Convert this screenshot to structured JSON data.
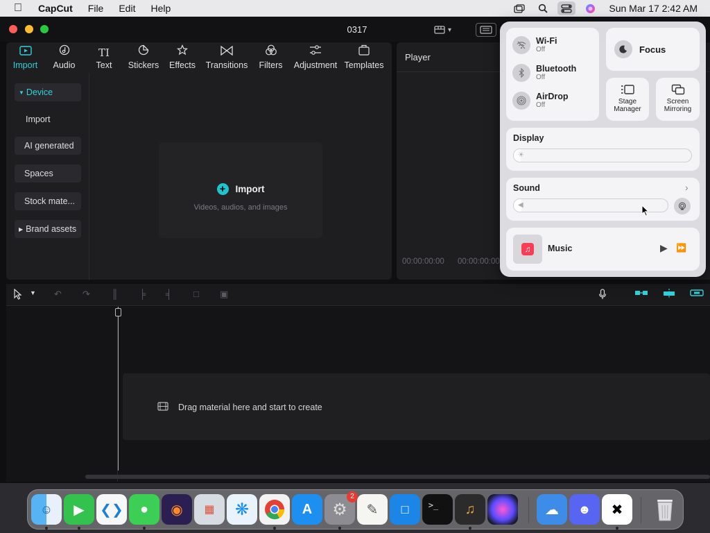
{
  "menubar": {
    "app_name": "CapCut",
    "menus": [
      "File",
      "Edit",
      "Help"
    ],
    "clock": "Sun Mar 17  2:42 AM"
  },
  "window": {
    "title": "0317"
  },
  "media": {
    "tabs": [
      {
        "label": "Import",
        "icon": "import-icon",
        "active": true
      },
      {
        "label": "Audio",
        "icon": "audio-icon"
      },
      {
        "label": "Text",
        "icon": "text-icon"
      },
      {
        "label": "Stickers",
        "icon": "stickers-icon"
      },
      {
        "label": "Effects",
        "icon": "effects-icon"
      },
      {
        "label": "Transitions",
        "icon": "transitions-icon"
      },
      {
        "label": "Filters",
        "icon": "filters-icon"
      },
      {
        "label": "Adjustment",
        "icon": "adjustment-icon"
      },
      {
        "label": "Templates",
        "icon": "templates-icon"
      }
    ],
    "sidebar": {
      "device": "Device",
      "import": "Import",
      "ai_generated": "AI generated",
      "spaces": "Spaces",
      "stock": "Stock mate...",
      "brand": "Brand assets"
    },
    "import_zone": {
      "title": "Import",
      "subtitle": "Videos, audios, and images"
    }
  },
  "player": {
    "title": "Player",
    "time_current": "00:00:00:00",
    "time_total": "00:00:00:00"
  },
  "timeline": {
    "drop_text": "Drag material here and start to create"
  },
  "control_center": {
    "wifi": {
      "name": "Wi-Fi",
      "state": "Off"
    },
    "bluetooth": {
      "name": "Bluetooth",
      "state": "Off"
    },
    "airdrop": {
      "name": "AirDrop",
      "state": "Off"
    },
    "focus": "Focus",
    "stage_manager": "Stage Manager",
    "screen_mirroring": "Screen Mirroring",
    "display": {
      "title": "Display",
      "level": 0.04
    },
    "sound": {
      "title": "Sound",
      "level": 0.05
    },
    "music": "Music"
  },
  "dock": {
    "apps": [
      "Finder",
      "FaceTime",
      "Visual Studio Code",
      "Messages",
      "Firefox",
      "Launchpad",
      "Safari",
      "Chrome",
      "App Store",
      "System Settings",
      "TextEdit",
      "Keynote",
      "Terminal",
      "GarageBand",
      "Siri",
      "Weather",
      "Discord",
      "CapCut",
      "Trash"
    ],
    "settings_badge": "2"
  }
}
